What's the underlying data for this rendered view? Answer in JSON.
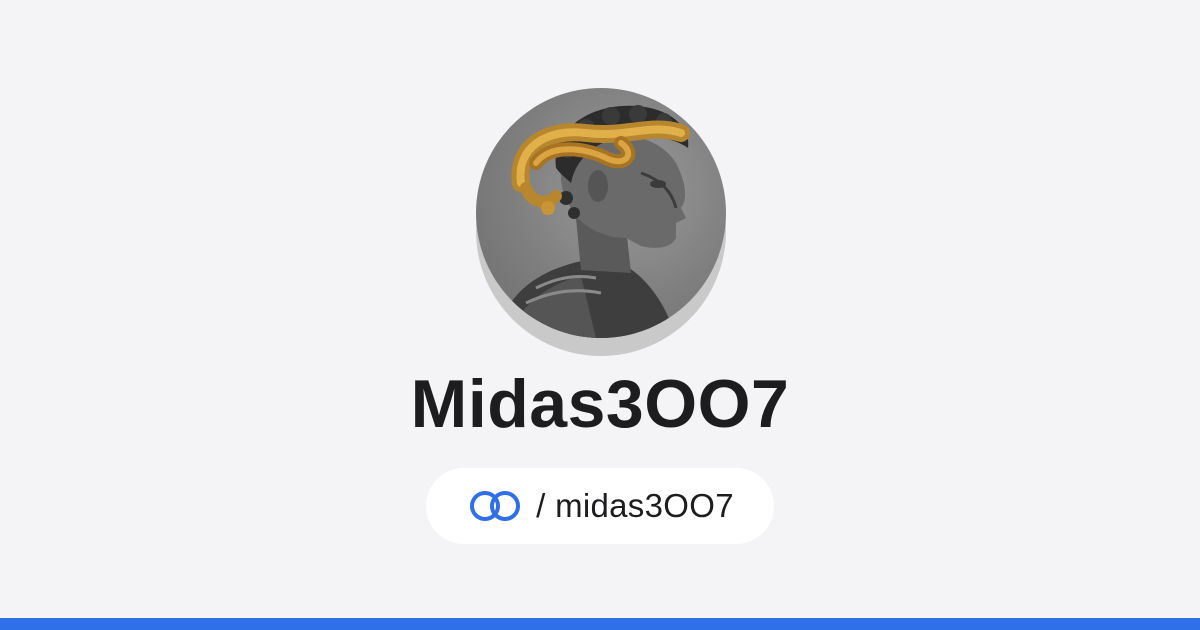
{
  "profile": {
    "display_name": "Midas3OO7",
    "avatar_icon": "statue-bust-with-golden-snake",
    "handle": "/ midas3OO7",
    "handle_icon": "linked-rings-icon"
  },
  "colors": {
    "background": "#f4f4f6",
    "accent": "#2f6fe8",
    "text": "#1d1d1f"
  }
}
